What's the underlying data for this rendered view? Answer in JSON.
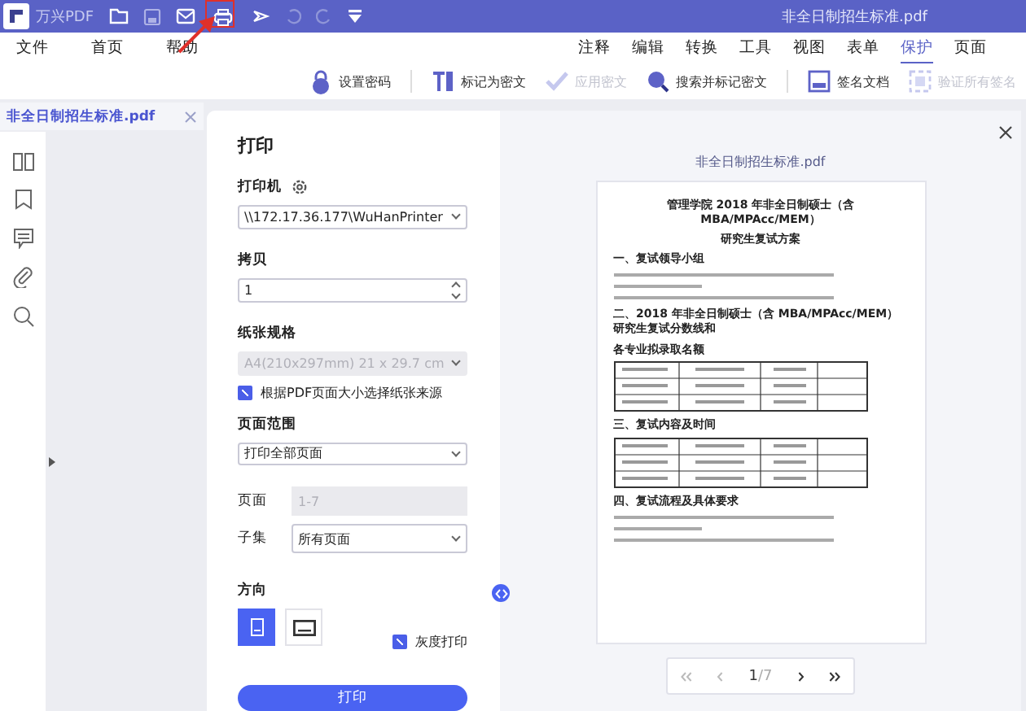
{
  "titlebar": {
    "app_name": "万兴PDF",
    "document_title": "非全日制招生标准.pdf"
  },
  "menu_left": [
    {
      "label": "文件"
    },
    {
      "label": "首页"
    },
    {
      "label": "帮助"
    }
  ],
  "menu_right": [
    {
      "label": "注释",
      "selected": false
    },
    {
      "label": "编辑",
      "selected": false
    },
    {
      "label": "转换",
      "selected": false
    },
    {
      "label": "工具",
      "selected": false
    },
    {
      "label": "视图",
      "selected": false
    },
    {
      "label": "表单",
      "selected": false
    },
    {
      "label": "保护",
      "selected": true
    },
    {
      "label": "页面",
      "selected": false
    }
  ],
  "toolbar": [
    {
      "kind": "lock",
      "label": "设置密码",
      "disabled": false
    },
    {
      "kind": "redact",
      "label": "标记为密文",
      "disabled": false
    },
    {
      "kind": "check",
      "label": "应用密文",
      "disabled": true
    },
    {
      "kind": "search",
      "label": "搜索并标记密文",
      "disabled": false
    },
    {
      "kind": "sign",
      "label": "签名文档",
      "disabled": false
    },
    {
      "kind": "verify",
      "label": "验证所有签名",
      "disabled": true
    }
  ],
  "file_tab": {
    "label": "非全日制招生标准.pdf"
  },
  "print_dialog": {
    "title": "打印",
    "printer": {
      "label": "打印机",
      "value": "\\\\172.17.36.177\\WuHanPrinter"
    },
    "copies": {
      "label": "拷贝",
      "value": "1"
    },
    "paper": {
      "label": "纸张规格",
      "value": "A4(210x297mm) 21 x 29.7 cm",
      "disabled": true
    },
    "paper_source": {
      "label": "根据PDF页面大小选择纸张来源",
      "checked": true
    },
    "range": {
      "label": "页面范围",
      "value": "打印全部页面"
    },
    "pages": {
      "label": "页面",
      "placeholder": "1-7"
    },
    "subset": {
      "label": "子集",
      "value": "所有页面"
    },
    "orientation": {
      "label": "方向",
      "options": [
        {
          "kind": "portrait",
          "selected": true
        },
        {
          "kind": "landscape",
          "selected": false
        }
      ]
    },
    "grayscale": {
      "label": "灰度打印",
      "checked": true
    },
    "print_button": "打印",
    "preview": {
      "file_name": "非全日制招生标准.pdf",
      "page": "1",
      "total": "/7",
      "document": [
        {
          "kind": "title",
          "text": "管理学院 2018 年非全日制硕士（含 MBA/MPAcc/MEM）"
        },
        {
          "kind": "title",
          "text": "研究生复试方案"
        },
        {
          "kind": "heading",
          "text": "一、复试领导小组"
        },
        {
          "kind": "lines"
        },
        {
          "kind": "heading",
          "text": "二、2018 年非全日制硕士（含 MBA/MPAcc/MEM）研究生复试分数线和"
        },
        {
          "kind": "heading",
          "text": "各专业拟录取名额"
        },
        {
          "kind": "table"
        },
        {
          "kind": "heading",
          "text": "三、复试内容及时间"
        },
        {
          "kind": "table"
        },
        {
          "kind": "heading",
          "text": "四、复试流程及具体要求"
        },
        {
          "kind": "lines"
        }
      ]
    }
  }
}
